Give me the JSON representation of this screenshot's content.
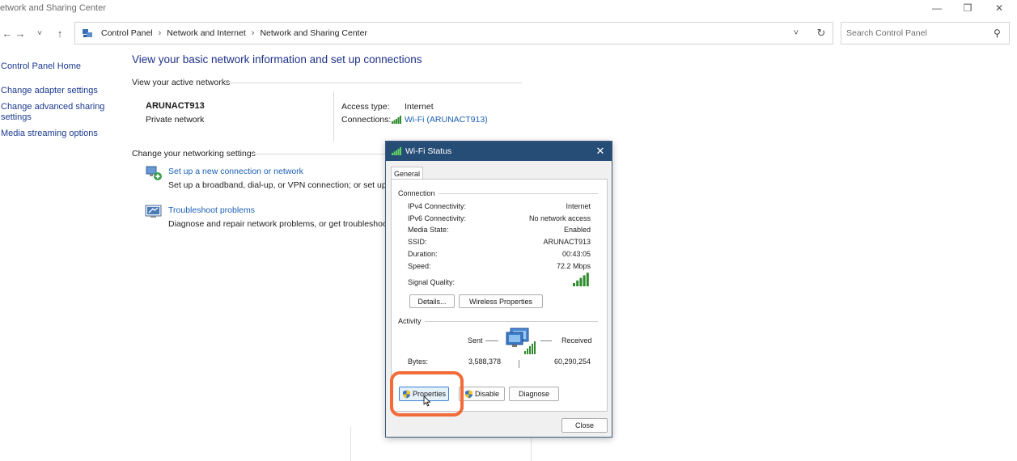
{
  "window": {
    "title": "etwork and Sharing Center",
    "minimize_glyph": "—",
    "restore_glyph": "❐",
    "close_glyph": "✕"
  },
  "nav": {
    "back_glyph": "←",
    "forward_glyph": "→",
    "recent_glyph": "˅",
    "up_glyph": "↑",
    "breadcrumbs": [
      "Control Panel",
      "Network and Internet",
      "Network and Sharing Center"
    ],
    "separator": "›",
    "dropdown_glyph": "˅",
    "refresh_glyph": "↻",
    "search_placeholder": "Search Control Panel",
    "search_glyph": "⚲"
  },
  "sidebar": {
    "items": [
      {
        "label": "Control Panel Home"
      },
      {
        "label": "Change adapter settings"
      },
      {
        "label": "Change advanced sharing settings"
      },
      {
        "label": "Media streaming options"
      }
    ]
  },
  "main": {
    "title": "View your basic network information and set up connections",
    "active_networks_heading": "View your active networks",
    "network": {
      "name": "ARUNACT913",
      "type": "Private network",
      "access_type_label": "Access type:",
      "access_type_value": "Internet",
      "connections_label": "Connections:",
      "connections_value": "Wi-Fi (ARUNACT913)"
    },
    "change_settings_heading": "Change your networking settings",
    "tasks": [
      {
        "link": "Set up a new connection or network",
        "desc": "Set up a broadband, dial-up, or VPN connection; or set up a r"
      },
      {
        "link": "Troubleshoot problems",
        "desc": "Diagnose and repair network problems, or get troubleshootir"
      }
    ]
  },
  "dialog": {
    "title": "Wi-Fi Status",
    "close_glyph": "✕",
    "tab": "General",
    "connection_group": "Connection",
    "rows": [
      {
        "label": "IPv4 Connectivity:",
        "value": "Internet"
      },
      {
        "label": "IPv6 Connectivity:",
        "value": "No network access"
      },
      {
        "label": "Media State:",
        "value": "Enabled"
      },
      {
        "label": "SSID:",
        "value": "ARUNACT913"
      },
      {
        "label": "Duration:",
        "value": "00:43:05"
      },
      {
        "label": "Speed:",
        "value": "72.2 Mbps"
      }
    ],
    "signal_label": "Signal Quality:",
    "signal_level": 5,
    "signal_max": 5,
    "details_button": "Details...",
    "wireless_properties_button": "Wireless Properties",
    "activity_group": "Activity",
    "sent_label": "Sent",
    "received_label": "Received",
    "bytes_label": "Bytes:",
    "bytes_sent": "3,588,378",
    "bytes_received": "60,290,254",
    "properties_button": "Properties",
    "disable_button": "Disable",
    "diagnose_button": "Diagnose",
    "close_button": "Close"
  },
  "colors": {
    "dialog_title_bg": "#264d76",
    "link": "#1b5fb4",
    "heading": "#1e3287",
    "signal": "#2e8b2e",
    "highlight": "#f26b38"
  }
}
